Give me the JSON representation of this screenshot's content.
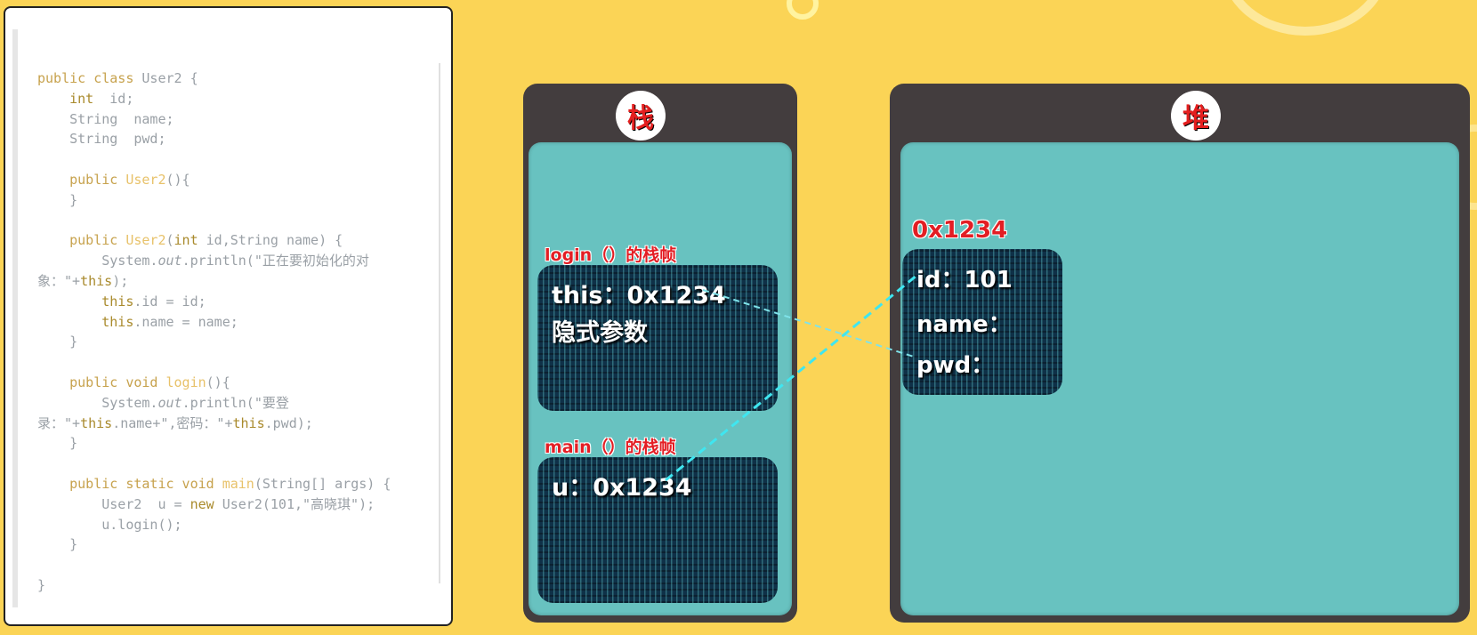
{
  "code": {
    "lines": [
      [
        {
          "t": "public class ",
          "c": "kw"
        },
        {
          "t": "User2 {",
          "c": ""
        }
      ],
      [
        {
          "t": "    ",
          "c": ""
        },
        {
          "t": "int",
          "c": "kwb"
        },
        {
          "t": "  id;",
          "c": ""
        }
      ],
      [
        {
          "t": "    String  name;",
          "c": ""
        }
      ],
      [
        {
          "t": "    String  pwd;",
          "c": ""
        }
      ],
      [
        {
          "t": "",
          "c": ""
        }
      ],
      [
        {
          "t": "    ",
          "c": ""
        },
        {
          "t": "public ",
          "c": "kw"
        },
        {
          "t": "User2",
          "c": "fn"
        },
        {
          "t": "(){",
          "c": ""
        }
      ],
      [
        {
          "t": "    }",
          "c": ""
        }
      ],
      [
        {
          "t": "",
          "c": ""
        }
      ],
      [
        {
          "t": "    ",
          "c": ""
        },
        {
          "t": "public ",
          "c": "kw"
        },
        {
          "t": "User2",
          "c": "fn"
        },
        {
          "t": "(",
          "c": ""
        },
        {
          "t": "int",
          "c": "kwb"
        },
        {
          "t": " id,String name) {",
          "c": ""
        }
      ],
      [
        {
          "t": "        System.",
          "c": ""
        },
        {
          "t": "out",
          "c": "it"
        },
        {
          "t": ".println(\"正在要初始化的对",
          "c": ""
        }
      ],
      [
        {
          "t": "象：\"+",
          "c": ""
        },
        {
          "t": "this",
          "c": "kwb"
        },
        {
          "t": ");",
          "c": ""
        }
      ],
      [
        {
          "t": "        ",
          "c": ""
        },
        {
          "t": "this",
          "c": "kwb"
        },
        {
          "t": ".id = id;",
          "c": ""
        }
      ],
      [
        {
          "t": "        ",
          "c": ""
        },
        {
          "t": "this",
          "c": "kwb"
        },
        {
          "t": ".name = name;",
          "c": ""
        }
      ],
      [
        {
          "t": "    }",
          "c": ""
        }
      ],
      [
        {
          "t": "",
          "c": ""
        }
      ],
      [
        {
          "t": "    ",
          "c": ""
        },
        {
          "t": "public void ",
          "c": "kw"
        },
        {
          "t": "login",
          "c": "fn"
        },
        {
          "t": "(){",
          "c": ""
        }
      ],
      [
        {
          "t": "        System.",
          "c": ""
        },
        {
          "t": "out",
          "c": "it"
        },
        {
          "t": ".println(\"要登",
          "c": ""
        }
      ],
      [
        {
          "t": "录：\"+",
          "c": ""
        },
        {
          "t": "this",
          "c": "kwb"
        },
        {
          "t": ".name+\",密码：\"+",
          "c": ""
        },
        {
          "t": "this",
          "c": "kwb"
        },
        {
          "t": ".pwd);",
          "c": ""
        }
      ],
      [
        {
          "t": "    }",
          "c": ""
        }
      ],
      [
        {
          "t": "",
          "c": ""
        }
      ],
      [
        {
          "t": "    ",
          "c": ""
        },
        {
          "t": "public static void ",
          "c": "kw"
        },
        {
          "t": "main",
          "c": "fn"
        },
        {
          "t": "(String[] args) {",
          "c": ""
        }
      ],
      [
        {
          "t": "        User2  u = ",
          "c": ""
        },
        {
          "t": "new",
          "c": "kwb"
        },
        {
          "t": " User2(101,\"高晓琪\");",
          "c": ""
        }
      ],
      [
        {
          "t": "        u.login();",
          "c": ""
        }
      ],
      [
        {
          "t": "    }",
          "c": ""
        }
      ],
      [
        {
          "t": "",
          "c": ""
        }
      ],
      [
        {
          "t": "}",
          "c": ""
        }
      ]
    ]
  },
  "stack": {
    "badge": "栈",
    "login_frame": {
      "label": "login（）的栈帧",
      "this_ref": "this：0x1234",
      "implicit": "隐式参数"
    },
    "main_frame": {
      "label": "main（）的栈帧",
      "u_ref": "u：0x1234"
    }
  },
  "heap": {
    "badge": "堆",
    "object": {
      "address": "0x1234",
      "id_field": "id：101",
      "name_field": "name：",
      "pwd_field": "pwd："
    }
  },
  "colors": {
    "background": "#fbd456",
    "panel_dark": "#433d3e",
    "panel_teal": "#68c2c0",
    "label_red": "#e31e24",
    "arrow_cyan": "#3fe6f0"
  }
}
